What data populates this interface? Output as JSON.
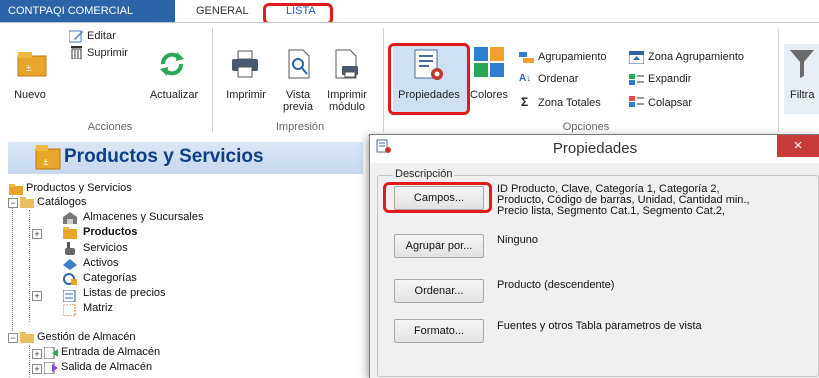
{
  "app": {
    "name": "CONTPAQI COMERCIAL"
  },
  "tabs": [
    {
      "label": "GENERAL"
    },
    {
      "label": "LISTA"
    }
  ],
  "ribbon": {
    "groups": {
      "acciones": "Acciones",
      "impresion": "Impresión",
      "opciones": "Opciones"
    },
    "buttons": {
      "nuevo": "Nuevo",
      "editar": "Editar",
      "suprimir": "Suprimir",
      "actualizar": "Actualizar",
      "imprimir": "Imprimir",
      "vista_previa_1": "Vista",
      "vista_previa_2": "previa",
      "imprimir_modulo_1": "Imprimir",
      "imprimir_modulo_2": "módulo",
      "propiedades": "Propiedades",
      "colores": "Colores",
      "agrupamiento": "Agrupamiento",
      "ordenar": "Ordenar",
      "zona_totales": "Zona Totales",
      "zona_agrupamiento": "Zona Agrupamiento",
      "expandir": "Expandir",
      "colapsar": "Colapsar",
      "filtrar": "Filtra"
    }
  },
  "leftpane": {
    "title": "Productos y Servicios",
    "tree": {
      "root": "Productos y Servicios",
      "catalogos": "Catálogos",
      "almacenes": "Almacenes y Sucursales",
      "productos": "Productos",
      "servicios": "Servicios",
      "activos": "Activos",
      "categorias": "Categorías",
      "listas": "Listas de precios",
      "matriz": "Matriz",
      "gestion": "Gestión de Almacén",
      "entrada": "Entrada de Almacén",
      "salida": "Salida de Almacén"
    }
  },
  "dialog": {
    "title": "Propiedades",
    "close": "×",
    "group_label": "Descripción",
    "rows": {
      "campos": {
        "button": "Campos...",
        "desc1": "ID Producto, Clave, Categoría 1, Categoría 2,",
        "desc2": "Producto, Código de barras, Unidad, Cantidad min.,",
        "desc3": "Precio lista, Segmento Cat.1, Segmento Cat.2,"
      },
      "agrupar": {
        "button": "Agrupar por...",
        "desc": "Ninguno"
      },
      "ordenar": {
        "button": "Ordenar...",
        "desc": "Producto (descendente)"
      },
      "formato": {
        "button": "Formato...",
        "desc": "Fuentes y otros Tabla parametros de vista"
      }
    }
  },
  "colors": {
    "accent": "#2b64a8",
    "highlight": "#e31a1a",
    "close": "#c83b3b"
  }
}
